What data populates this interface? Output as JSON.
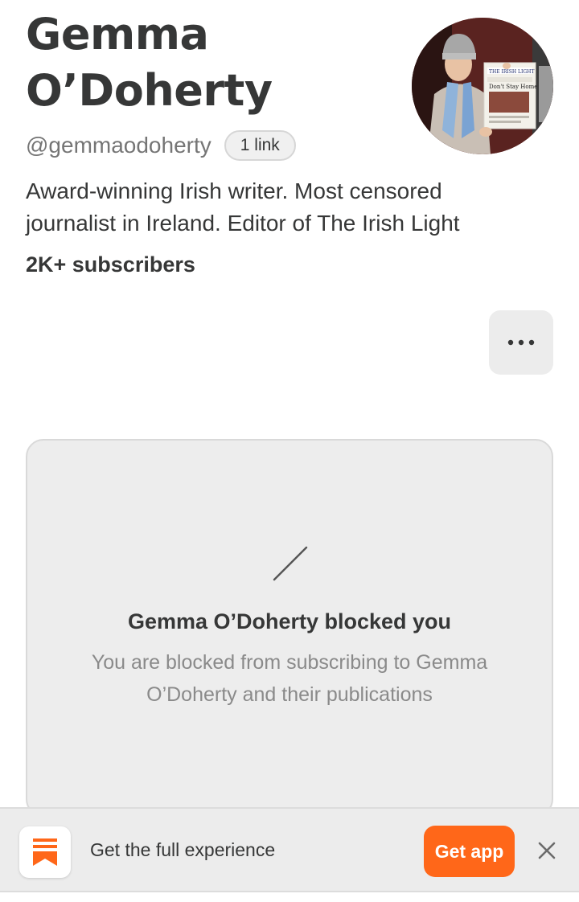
{
  "profile": {
    "name": "Gemma O’Doherty",
    "handle": "@gemmaodoherty",
    "links_label": "1 link",
    "bio": "Award-winning Irish writer. Most censored journalist in Ireland. Editor of The Irish Light",
    "subscribers": "2K+ subscribers",
    "avatar": {
      "newspaper_masthead": "THE IRISH LIGHT",
      "newspaper_headline": "Don't Stay Home"
    }
  },
  "blocked": {
    "title": "Gemma O’Doherty blocked you",
    "description": "You are blocked from subscribing to Gemma O’Doherty and their publications"
  },
  "app_banner": {
    "text": "Get the full experience",
    "button_label": "Get app"
  },
  "colors": {
    "accent": "#ff6719",
    "text": "#363737",
    "muted": "#757575",
    "card_bg": "#ededed"
  }
}
